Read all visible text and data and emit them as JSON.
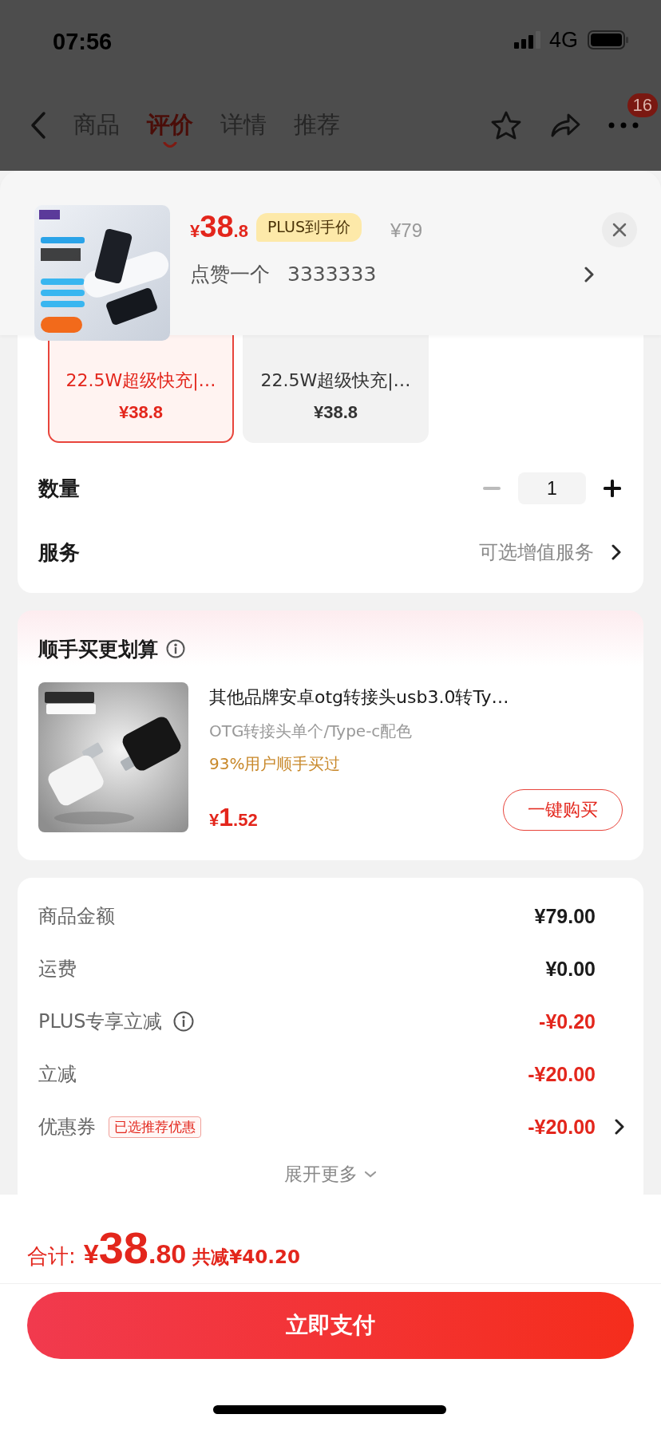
{
  "status_bar": {
    "time": "07:56",
    "network": "4G"
  },
  "nav": {
    "tabs": [
      {
        "label": "商品",
        "selected": false
      },
      {
        "label": "评价",
        "selected": true
      },
      {
        "label": "详情",
        "selected": false
      },
      {
        "label": "推荐",
        "selected": false
      }
    ],
    "more_badge": "16"
  },
  "sheet_header": {
    "price_symbol": "¥",
    "price_int": "38",
    "price_dec": ".8",
    "price_tag": "PLUS到手价",
    "original_price": "¥79",
    "selected_spec": "点赞一个",
    "spec_value": "3333333"
  },
  "variants": [
    {
      "title": "22.5W超级快充|…",
      "price": "¥38.8",
      "selected": true
    },
    {
      "title": "22.5W超级快充|…",
      "price": "¥38.8",
      "selected": false
    }
  ],
  "quantity": {
    "label": "数量",
    "value": "1"
  },
  "service": {
    "label": "服务",
    "value": "可选增值服务"
  },
  "addon": {
    "title": "顺手买更划算",
    "product": {
      "title": "其他品牌安卓otg转接头usb3.0转Ty…",
      "spec": "OTG转接头单个/Type-c配色",
      "note": "93%用户顺手买过",
      "price_symbol": "¥",
      "price_int": "1",
      "price_dec": ".52",
      "button": "一键购买"
    }
  },
  "summary": {
    "rows": [
      {
        "label": "商品金额",
        "value": "¥79.00",
        "kind": "plain",
        "info": false,
        "link": false
      },
      {
        "label": "运费",
        "value": "¥0.00",
        "kind": "plain",
        "info": false,
        "link": false
      },
      {
        "label": "PLUS专享立减",
        "value": "-¥0.20",
        "kind": "discount",
        "info": true,
        "link": false
      },
      {
        "label": "立减",
        "value": "-¥20.00",
        "kind": "discount",
        "info": false,
        "link": false
      },
      {
        "label": "优惠券",
        "tag": "已选推荐优惠",
        "value": "-¥20.00",
        "kind": "discount",
        "info": false,
        "link": true
      }
    ],
    "expand": "展开更多"
  },
  "footer": {
    "total_label": "合计:",
    "total_symbol": "¥",
    "total_int": "38",
    "total_dec": ".80",
    "saved": "共减¥40.20",
    "pay_button": "立即支付"
  }
}
